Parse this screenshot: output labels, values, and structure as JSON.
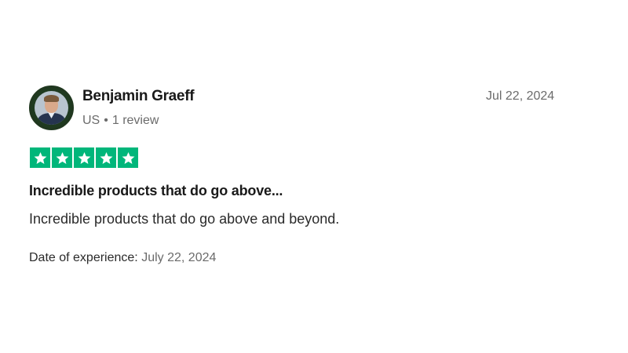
{
  "review": {
    "reviewer_name": "Benjamin Graeff",
    "country": "US",
    "separator": "•",
    "review_count": "1 review",
    "posted_date": "Jul 22, 2024",
    "rating": 5,
    "rating_max": 5,
    "title": "Incredible products that do go above...",
    "body": "Incredible products that do go above and beyond.",
    "experience_label": "Date of experience:",
    "experience_date": "July 22, 2024"
  },
  "colors": {
    "star_green": "#00b67a",
    "avatar_ring": "#20371f"
  },
  "icons": {
    "avatar": "reviewer-avatar",
    "star": "star-icon"
  }
}
